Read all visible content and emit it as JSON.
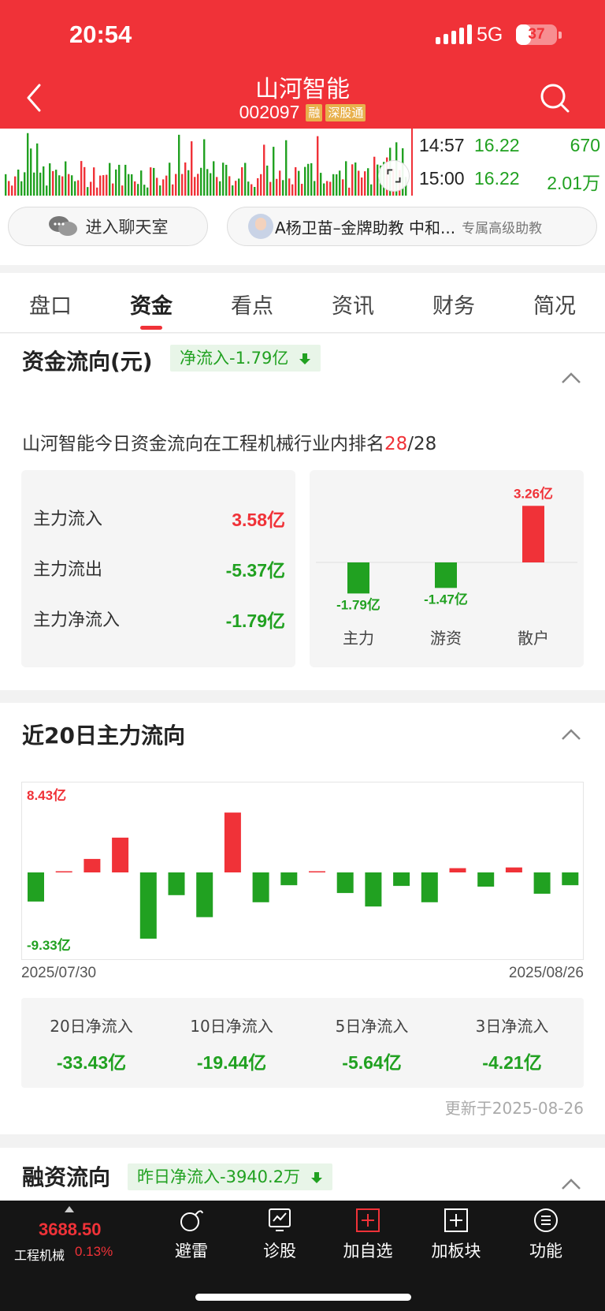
{
  "status_bar": {
    "time": "20:54",
    "network": "5G",
    "battery": "37",
    "battery_level": 0.37
  },
  "header": {
    "stock_name": "山河智能",
    "stock_code": "002097",
    "tags": [
      "融",
      "深股通"
    ]
  },
  "ticks": [
    {
      "time": "14:57",
      "price": "16.22",
      "volume": "670"
    },
    {
      "time": "15:00",
      "price": "16.22",
      "volume": "2.01万"
    }
  ],
  "chat": {
    "chat_label": "进入聊天室",
    "advisor_name": "A杨卫苗–金牌助教 中和...",
    "advisor_hint": "专属高级助教"
  },
  "tabs": [
    "盘口",
    "资金",
    "看点",
    "资讯",
    "财务",
    "简况"
  ],
  "active_tab": 1,
  "capital_flow": {
    "title": "资金流向(元)",
    "net_pill": "净流入-1.79亿",
    "rank_prefix": "山河智能今日资金流向在工程机械行业内排名",
    "rank": "28",
    "rank_total": "/28",
    "rows": [
      {
        "label": "主力流入",
        "value": "3.58亿",
        "color": "#f03238"
      },
      {
        "label": "主力流出",
        "value": "-5.37亿",
        "color": "#21a121"
      },
      {
        "label": "主力净流入",
        "value": "-1.79亿",
        "color": "#21a121"
      }
    ]
  },
  "chart_data": [
    {
      "type": "bar",
      "categories": [
        "主力",
        "游资",
        "散户"
      ],
      "values": [
        -1.79,
        -1.47,
        3.26
      ],
      "value_labels": [
        "-1.79亿",
        "-1.47亿",
        "3.26亿"
      ],
      "unit": "亿",
      "colors": {
        "positive": "#f03238",
        "negative": "#21a121"
      }
    },
    {
      "type": "bar",
      "title": "近20日主力流向",
      "values": [
        -4.1,
        0.15,
        1.9,
        4.9,
        -9.33,
        -3.2,
        -6.3,
        8.43,
        -4.2,
        -1.8,
        0.1,
        -2.9,
        -4.8,
        -1.9,
        -4.2,
        0.6,
        -2.0,
        0.7,
        -3.0,
        -1.8
      ],
      "max_label": "8.43亿",
      "min_label": "-9.33亿",
      "x_start": "2025/07/30",
      "x_end": "2025/08/26",
      "colors": {
        "positive": "#f03238",
        "negative": "#21a121"
      }
    }
  ],
  "trend20": {
    "title": "近20日主力流向",
    "date_start": "2025/07/30",
    "date_end": "2025/08/26",
    "summary": [
      {
        "label": "20日净流入",
        "value": "-33.43亿"
      },
      {
        "label": "10日净流入",
        "value": "-19.44亿"
      },
      {
        "label": "5日净流入",
        "value": "-5.64亿"
      },
      {
        "label": "3日净流入",
        "value": "-4.21亿"
      }
    ],
    "updated": "更新于2025-08-26"
  },
  "margin": {
    "title": "融资流向",
    "pill": "昨日净流入-3940.2万"
  },
  "bottom_nav": {
    "index_value": "3688.50",
    "index_name": "工程机械",
    "index_pct": "0.13%",
    "items": [
      {
        "label": "避雷",
        "icon": "bomb-icon"
      },
      {
        "label": "诊股",
        "icon": "diagnose-icon"
      },
      {
        "label": "加自选",
        "icon": "add-watchlist-icon"
      },
      {
        "label": "加板块",
        "icon": "add-sector-icon"
      },
      {
        "label": "功能",
        "icon": "menu-icon"
      }
    ]
  }
}
